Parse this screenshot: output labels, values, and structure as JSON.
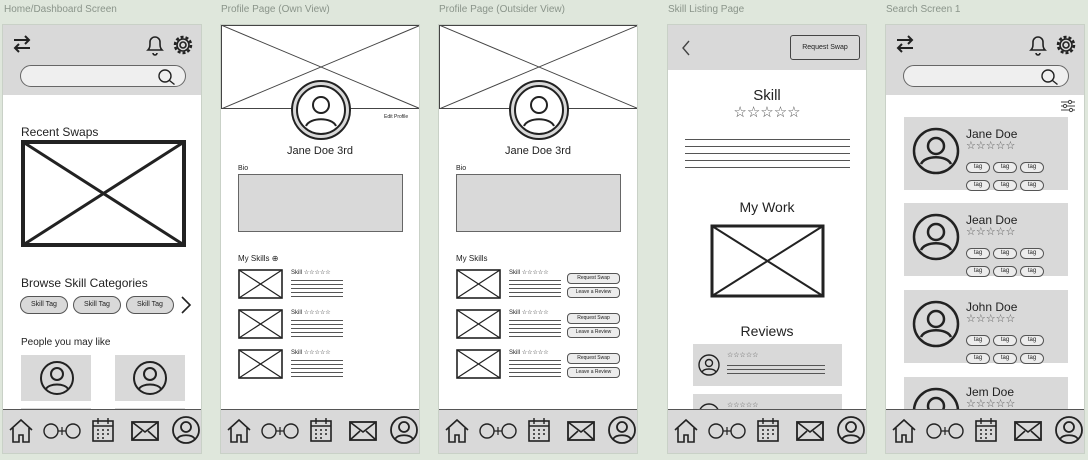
{
  "frames": {
    "home": "Home/Dashboard Screen",
    "profile_own": "Profile Page (Own View)",
    "profile_outsider": "Profile Page (Outsider View)",
    "skill_listing": "Skill Listing Page",
    "search": "Search Screen 1"
  },
  "home": {
    "recent_swaps": "Recent Swaps",
    "browse_categories": "Browse Skill Categories",
    "skill_tags": [
      "Skill Tag",
      "Skill Tag",
      "Skill Tag"
    ],
    "people_like": "People you may like"
  },
  "profile_own": {
    "edit_profile": "Edit Profile",
    "name": "Jane Doe 3rd",
    "bio": "Bio",
    "my_skills": "My Skills",
    "add_symbol": "⊕",
    "skill_label": "Skill",
    "stars": "☆☆☆☆☆"
  },
  "profile_outsider": {
    "name": "Jane Doe 3rd",
    "bio": "Bio",
    "my_skills": "My Skills",
    "skill_label": "Skill",
    "stars": "☆☆☆☆☆",
    "request_swap": "Request Swap",
    "leave_review": "Leave a Review"
  },
  "skill_listing": {
    "request_swap": "Request Swap",
    "skill_title": "Skill",
    "stars": "☆☆☆☆☆",
    "my_work": "My Work",
    "reviews": "Reviews",
    "review_stars": "☆☆☆☆☆"
  },
  "search_screen": {
    "results": [
      {
        "name": "Jane Doe",
        "stars": "☆☆☆☆☆",
        "tags": [
          "tag",
          "tag",
          "tag",
          "tag",
          "tag",
          "tag"
        ]
      },
      {
        "name": "Jean Doe",
        "stars": "☆☆☆☆☆",
        "tags": [
          "tag",
          "tag",
          "tag",
          "tag",
          "tag",
          "tag"
        ]
      },
      {
        "name": "John Doe",
        "stars": "☆☆☆☆☆",
        "tags": [
          "tag",
          "tag",
          "tag",
          "tag",
          "tag",
          "tag"
        ]
      },
      {
        "name": "Jem Doe",
        "stars": "☆☆☆☆☆",
        "tags": []
      }
    ]
  },
  "icons": [
    "swap-arrows-icon",
    "bell-icon",
    "gear-icon",
    "search-icon",
    "home-icon",
    "people-icon",
    "calendar-icon",
    "mail-icon",
    "profile-icon",
    "back-icon",
    "filter-icon",
    "avatar-icon",
    "chevron-right-icon"
  ]
}
